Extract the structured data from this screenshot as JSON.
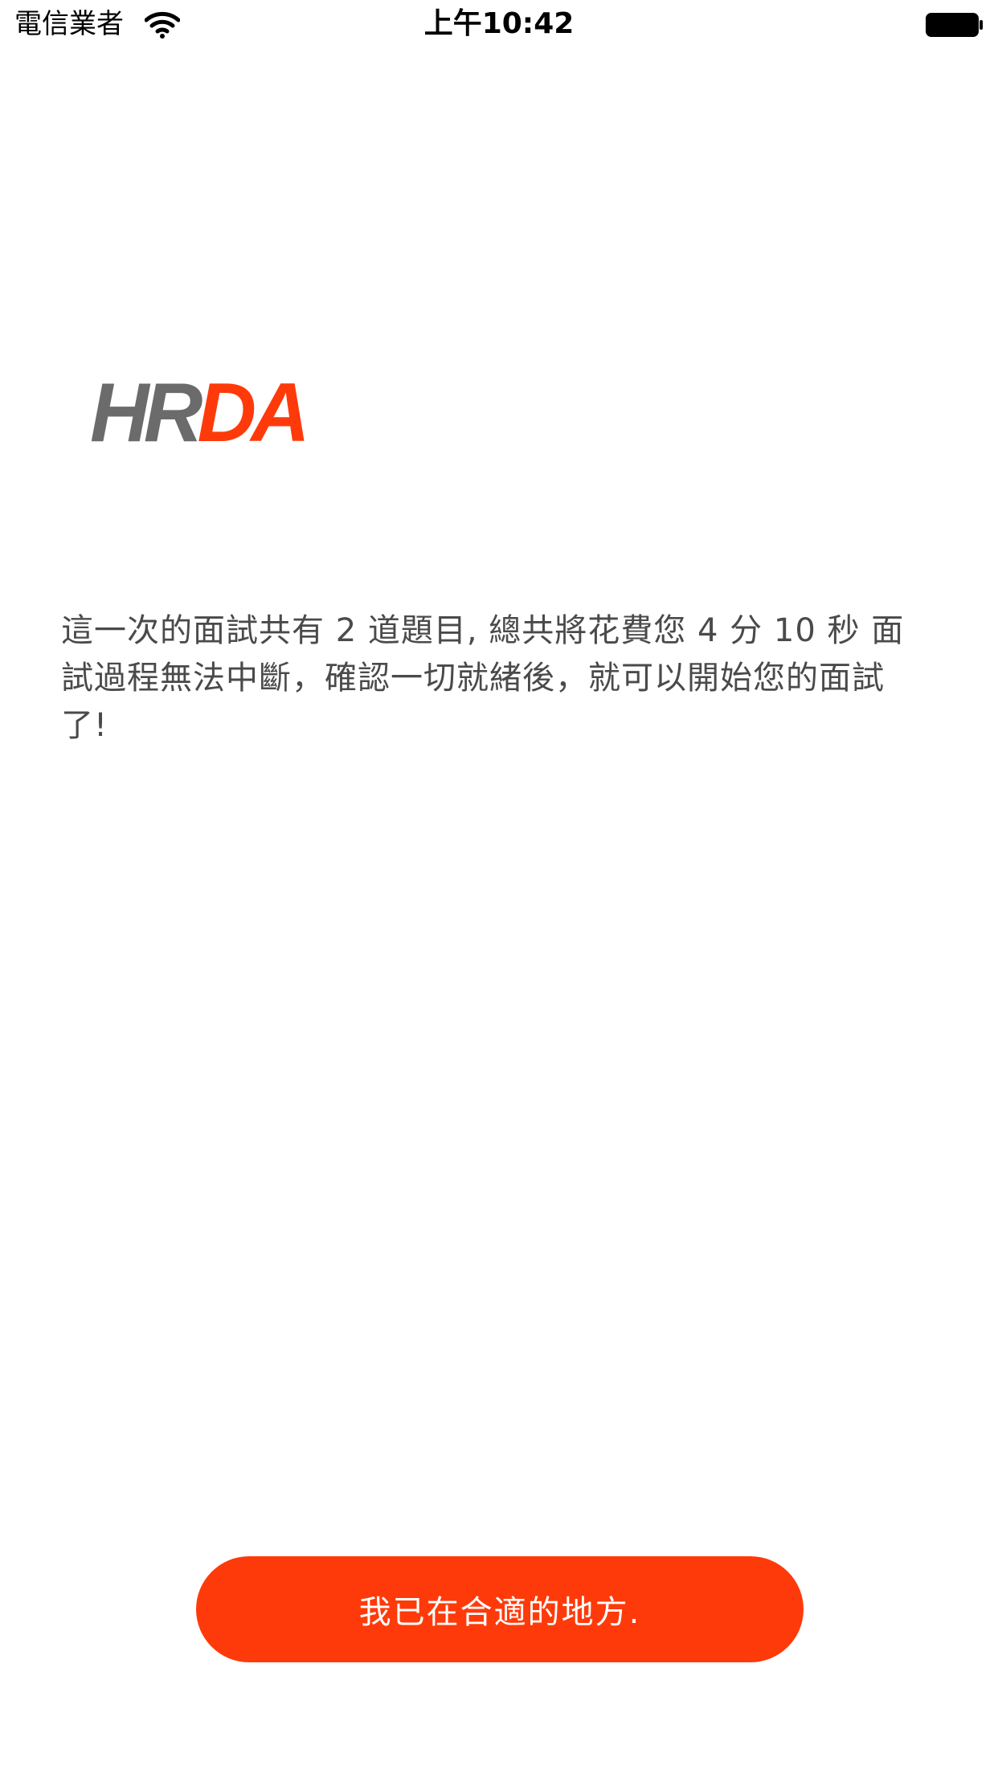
{
  "status_bar": {
    "carrier": "電信業者",
    "time": "上午10:42",
    "icons": {
      "wifi": "wifi-icon",
      "battery": "battery-icon"
    }
  },
  "logo": {
    "part1": "HR",
    "part2": "DA",
    "colors": {
      "part1": "#6b6b6b",
      "part2": "#ff3a0a"
    }
  },
  "message": "這一次的面試共有 2 道題目, 總共將花費您 4 分 10 秒 面試過程無法中斷，確認一切就緒後，就可以開始您的面試了!",
  "confirm_button": {
    "label": "我已在合適的地方."
  },
  "colors": {
    "accent": "#ff3a0a",
    "text": "#4a4a4a",
    "background": "#ffffff"
  }
}
